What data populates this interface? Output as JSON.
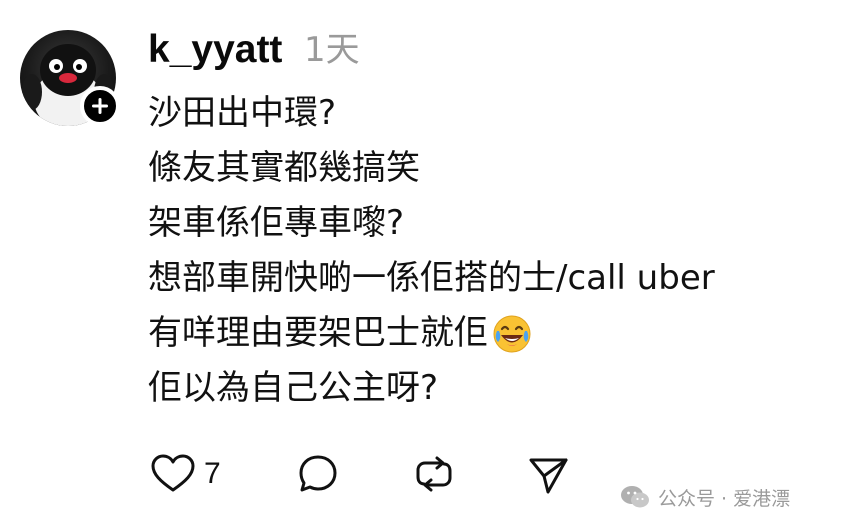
{
  "post": {
    "username": "k_yyatt",
    "timestamp": "1天",
    "lines": [
      "沙田出中環?",
      "條友其實都幾搞笑",
      "架車係佢專車嚟?",
      "想部車開快啲一係佢搭的士/call uber",
      "有咩理由要架巴士就佢",
      "佢以為自己公主呀?"
    ],
    "line5_emoji": "face-with-tears-of-joy",
    "like_count": "7"
  },
  "icons": {
    "follow": "plus-icon",
    "like": "heart-icon",
    "reply": "comment-bubble-icon",
    "repost": "repost-icon",
    "share": "send-icon",
    "watermark": "wechat-icon"
  },
  "watermark": {
    "text": "公众号 · 爱港漂"
  },
  "colors": {
    "text": "#111111",
    "muted": "#9a9a9a",
    "background": "#ffffff"
  }
}
